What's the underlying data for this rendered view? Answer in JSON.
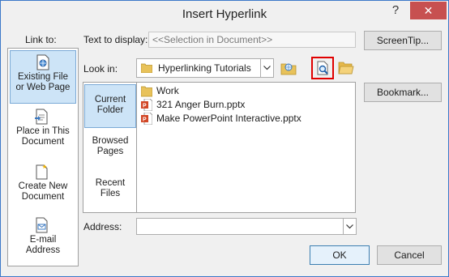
{
  "title": "Insert Hyperlink",
  "titlebar": {
    "help": "?",
    "close": "✕"
  },
  "link_to": {
    "label": "Link to:",
    "items": [
      {
        "line1": "Existing File",
        "line2": "or Web Page",
        "selected": true
      },
      {
        "line1": "Place in This",
        "line2": "Document",
        "selected": false
      },
      {
        "line1": "Create New",
        "line2": "Document",
        "selected": false
      },
      {
        "line1": "E-mail",
        "line2": "Address",
        "selected": false
      }
    ]
  },
  "text_to_display": {
    "label": "Text to display:",
    "value": "<<Selection in Document>>"
  },
  "screentip_button": "ScreenTip...",
  "look_in": {
    "label": "Look in:",
    "value": "Hyperlinking Tutorials"
  },
  "side_nav": [
    {
      "line1": "Current",
      "line2": "Folder",
      "selected": true
    },
    {
      "line1": "Browsed",
      "line2": "Pages",
      "selected": false
    },
    {
      "line1": "Recent",
      "line2": "Files",
      "selected": false
    }
  ],
  "files": [
    {
      "name": "Work",
      "icon": "folder-icon"
    },
    {
      "name": "321 Anger Burn.pptx",
      "icon": "pptx-file-icon"
    },
    {
      "name": "Make PowerPoint Interactive.pptx",
      "icon": "pptx-file-icon"
    }
  ],
  "bookmark_button": "Bookmark...",
  "address": {
    "label": "Address:",
    "value": ""
  },
  "ok_button": "OK",
  "cancel_button": "Cancel",
  "colors": {
    "accent": "#3c78c8",
    "selection": "#cde4f7",
    "highlight_box": "#e00000",
    "close": "#c75050"
  }
}
